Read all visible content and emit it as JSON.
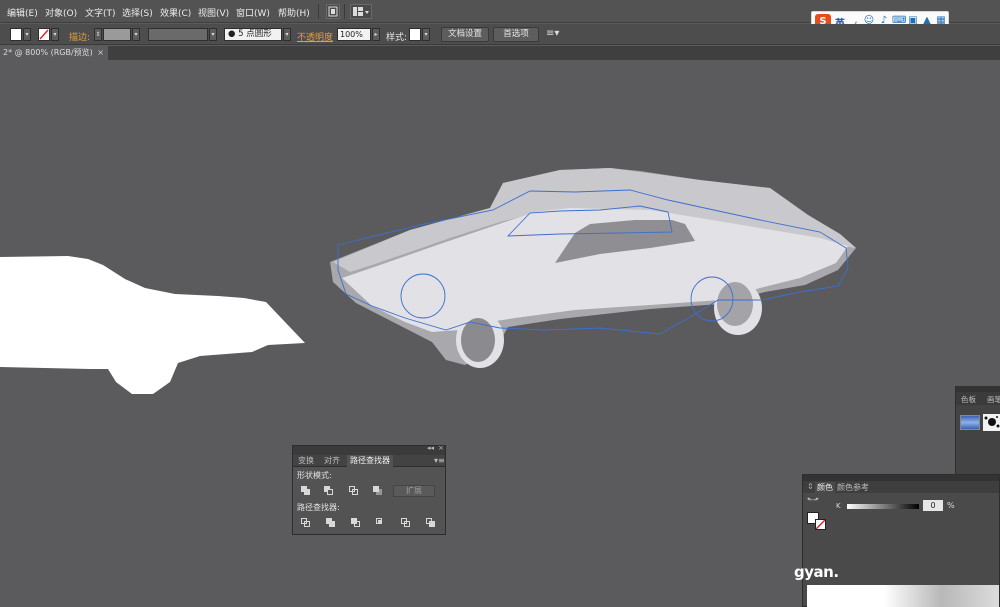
{
  "menubar": {
    "items": [
      "编辑(E)",
      "对象(O)",
      "文字(T)",
      "选择(S)",
      "效果(C)",
      "视图(V)",
      "窗口(W)",
      "帮助(H)"
    ]
  },
  "ime": {
    "logo": "S",
    "lang": "英"
  },
  "controlbar": {
    "stroke_label": "描边:",
    "brush_label": "5 点圆形",
    "opacity_label": "不透明度",
    "opacity_value": "100%",
    "style_label": "样式:",
    "doc_setup": "文档设置",
    "preferences": "首选项"
  },
  "document": {
    "tab_title": "2* @ 800% (RGB/预览)",
    "close": "×"
  },
  "pathfinder": {
    "collapse": "◂◂",
    "close": "×",
    "tabs": [
      "变换",
      "对齐",
      "路径查找器"
    ],
    "menu": "▾≡",
    "shape_modes_label": "形状模式:",
    "pathfinders_label": "路径查找器:",
    "expand": "扩展"
  },
  "swatches": {
    "tabs": [
      "色板",
      "画笔"
    ]
  },
  "color": {
    "tabs": [
      "颜色",
      "颜色参考"
    ],
    "k_label": "K",
    "k_value": "0",
    "percent": "%",
    "watermark": "gyan."
  },
  "colors": {
    "canvas": "#5b5a5c",
    "panel": "#535353",
    "shape_white": "#ffffff",
    "car_body": "#e0dfe3",
    "selection_outline": "#3d6fd0",
    "accent_orange": "#e0a040"
  }
}
